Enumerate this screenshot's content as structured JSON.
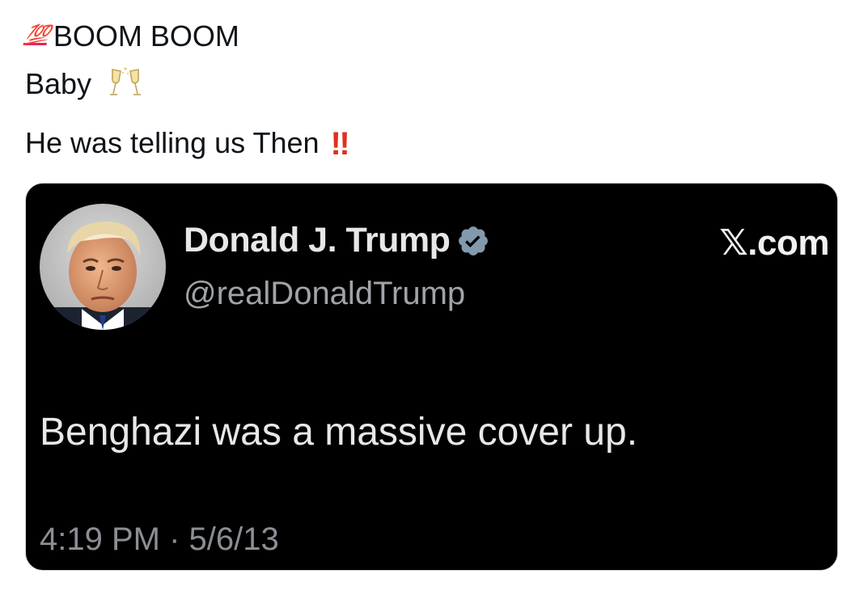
{
  "post": {
    "line1_emoji": "💯",
    "line1_emoji_name": "hundred-points-icon",
    "line1_text": "BOOM BOOM",
    "line2_text": "Baby",
    "line2_emoji_name": "clinking-glasses-icon",
    "line3_text": "He was telling us Then",
    "line3_emoji": "‼",
    "line3_emoji_name": "double-exclamation-icon"
  },
  "embedded_tweet": {
    "display_name": "Donald J. Trump",
    "verified_icon": "verified-badge-icon",
    "handle": "@realDonaldTrump",
    "brand": "𝕏.com",
    "body": "Benghazi was a massive cover up.",
    "timestamp": "4:19 PM · 5/6/13",
    "colors": {
      "background": "#000000",
      "name": "#e7e7e7",
      "handle": "#a0a4a8",
      "verified": "#829aab"
    }
  }
}
